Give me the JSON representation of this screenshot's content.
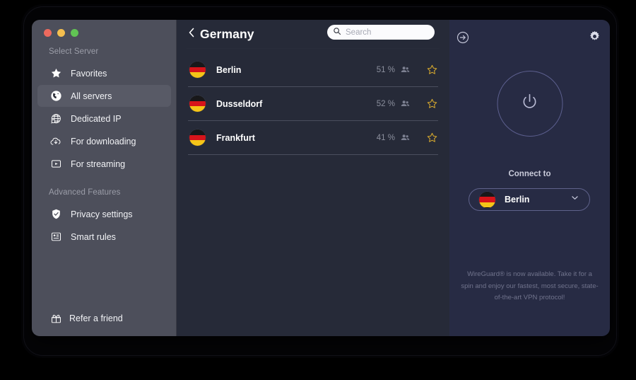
{
  "window": {
    "traffic_lights": [
      {
        "name": "close",
        "color": "#ed6a5e"
      },
      {
        "name": "minimize",
        "color": "#f5bf4f"
      },
      {
        "name": "zoom",
        "color": "#61c454"
      }
    ]
  },
  "sidebar": {
    "section_1_title": "Select Server",
    "section_1_items": [
      {
        "label": "Favorites",
        "icon": "star-icon",
        "active": false
      },
      {
        "label": "All servers",
        "icon": "globe-icon",
        "active": true
      },
      {
        "label": "Dedicated IP",
        "icon": "dedicated-ip-icon",
        "active": false
      },
      {
        "label": "For downloading",
        "icon": "cloud-download-icon",
        "active": false
      },
      {
        "label": "For streaming",
        "icon": "play-box-icon",
        "active": false
      }
    ],
    "section_2_title": "Advanced Features",
    "section_2_items": [
      {
        "label": "Privacy settings",
        "icon": "shield-check-icon",
        "active": false
      },
      {
        "label": "Smart rules",
        "icon": "smart-rules-icon",
        "active": false
      }
    ],
    "refer_label": "Refer a friend",
    "refer_icon": "gift-icon"
  },
  "main": {
    "back_icon": "chevron-left-icon",
    "title": "Germany",
    "search": {
      "placeholder": "Search",
      "value": "",
      "icon": "search-icon"
    },
    "servers": [
      {
        "name": "Berlin",
        "load": "51 %",
        "users_icon": "people-icon",
        "favorite_icon": "star-outline-icon",
        "flag": "germany"
      },
      {
        "name": "Dusseldorf",
        "load": "52 %",
        "users_icon": "people-icon",
        "favorite_icon": "star-outline-icon",
        "flag": "germany"
      },
      {
        "name": "Frankfurt",
        "load": "41 %",
        "users_icon": "people-icon",
        "favorite_icon": "star-outline-icon",
        "flag": "germany"
      }
    ]
  },
  "right_panel": {
    "expand_icon": "arrow-right-circle-icon",
    "settings_icon": "gear-icon",
    "power_icon": "power-icon",
    "connect_to_label": "Connect to",
    "selected_server": "Berlin",
    "selected_flag": "germany",
    "dropdown_icon": "chevron-down-icon",
    "promo_text": "WireGuard® is now available. Take it for a spin and enjoy our fastest, most secure, state-of-the-art VPN protocol!"
  },
  "colors": {
    "sidebar_bg": "#4d4f5b",
    "main_bg": "#262a38",
    "right_bg": "#272b44",
    "accent_star": "#d5a82e",
    "accent_ring": "#5c5f8e"
  }
}
